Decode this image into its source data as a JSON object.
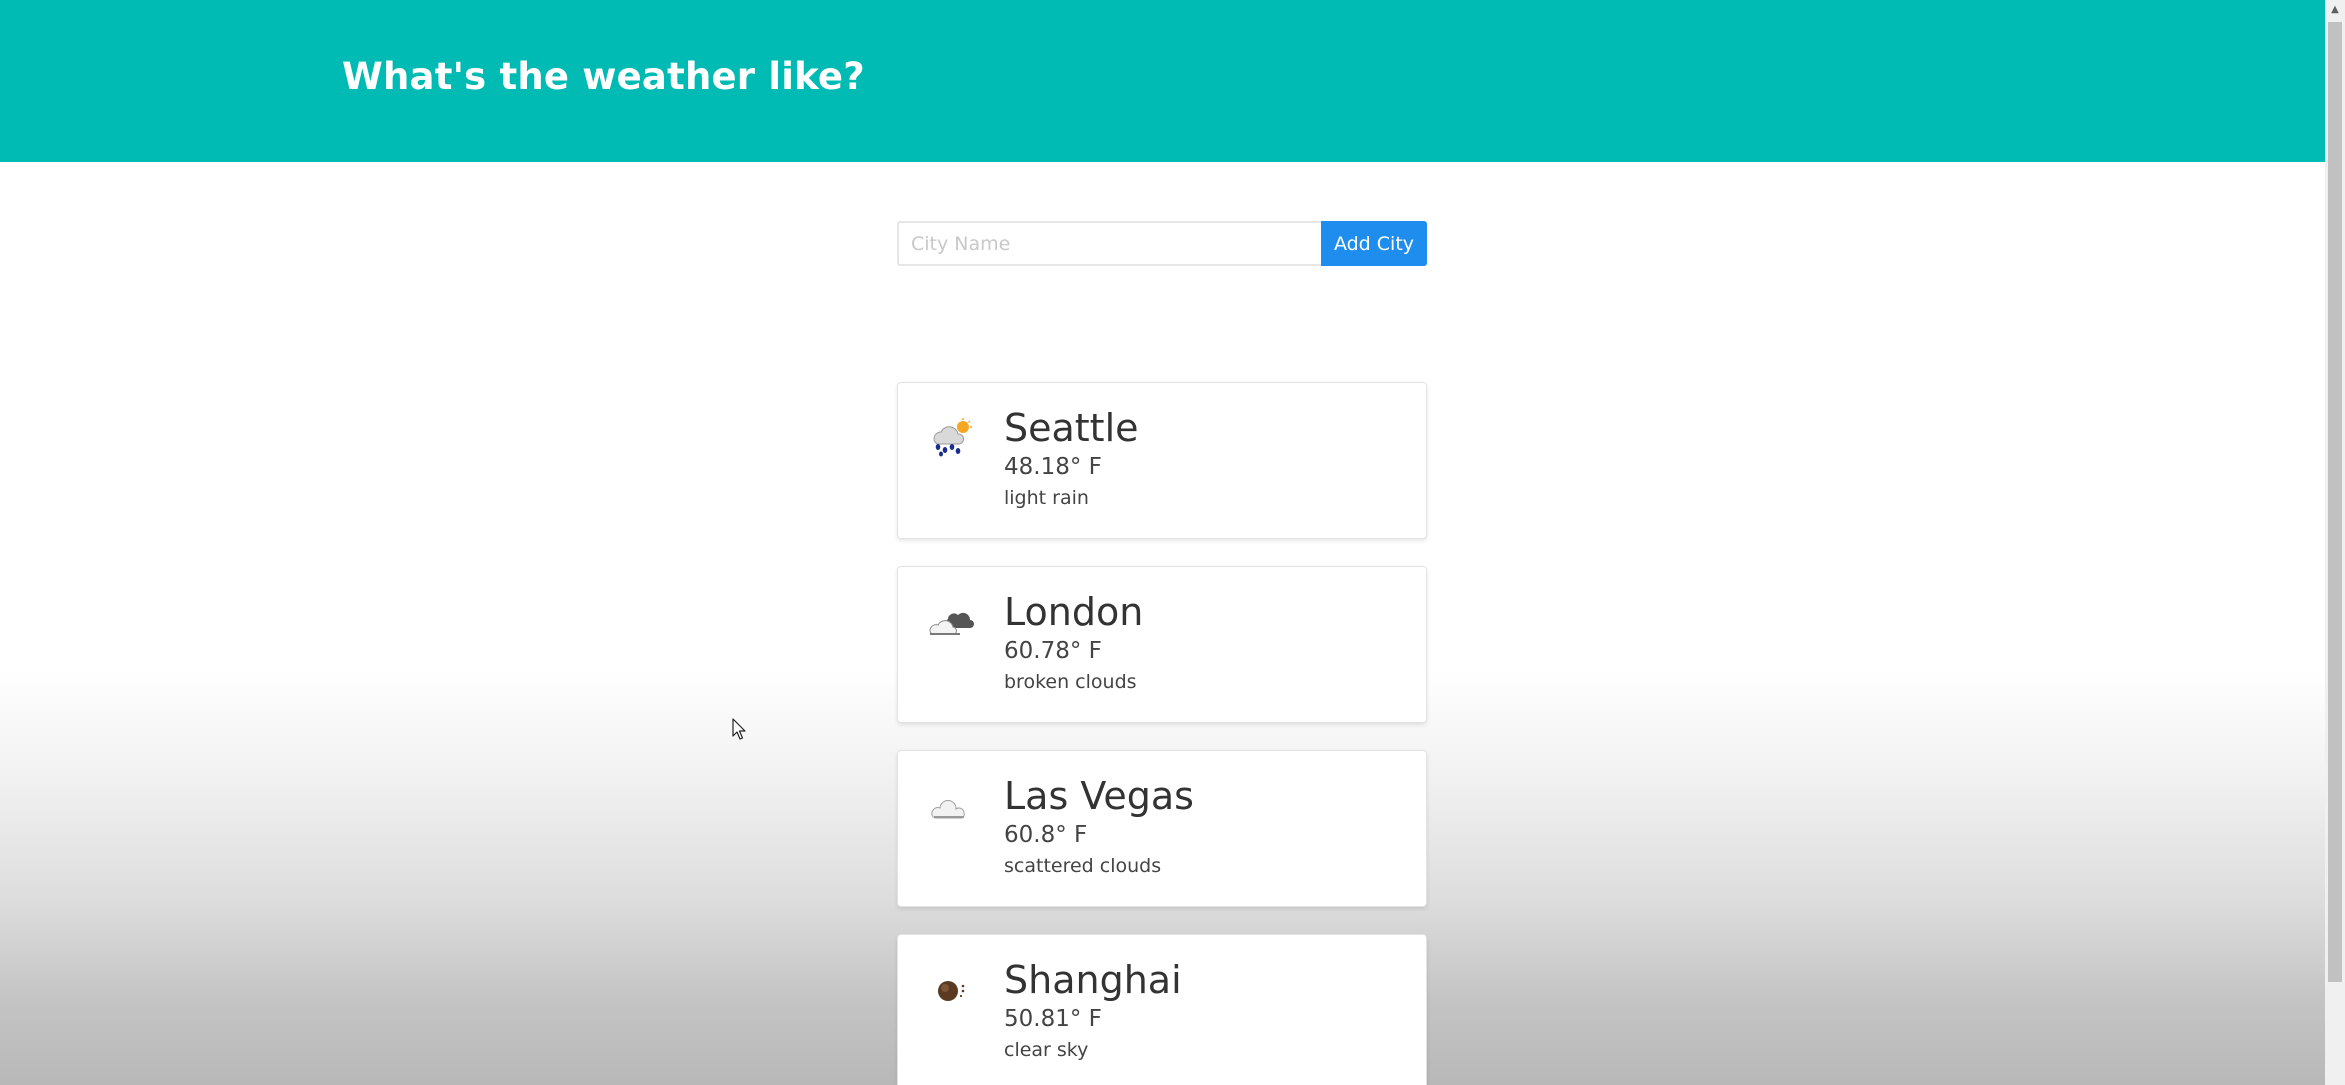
{
  "header": {
    "title": "What's the weather like?"
  },
  "search": {
    "placeholder": "City Name",
    "value": "",
    "button_label": "Add City"
  },
  "cities": [
    {
      "name": "Seattle",
      "temperature": "48.18° F",
      "description": "light rain",
      "icon": "light-rain-icon"
    },
    {
      "name": "London",
      "temperature": "60.78° F",
      "description": "broken clouds",
      "icon": "broken-clouds-icon"
    },
    {
      "name": "Las Vegas",
      "temperature": "60.8° F",
      "description": "scattered clouds",
      "icon": "scattered-clouds-icon"
    },
    {
      "name": "Shanghai",
      "temperature": "50.81° F",
      "description": "clear sky",
      "icon": "clear-sky-icon"
    }
  ],
  "colors": {
    "header_bg": "#00bbb4",
    "button_bg": "#1f8ded"
  }
}
